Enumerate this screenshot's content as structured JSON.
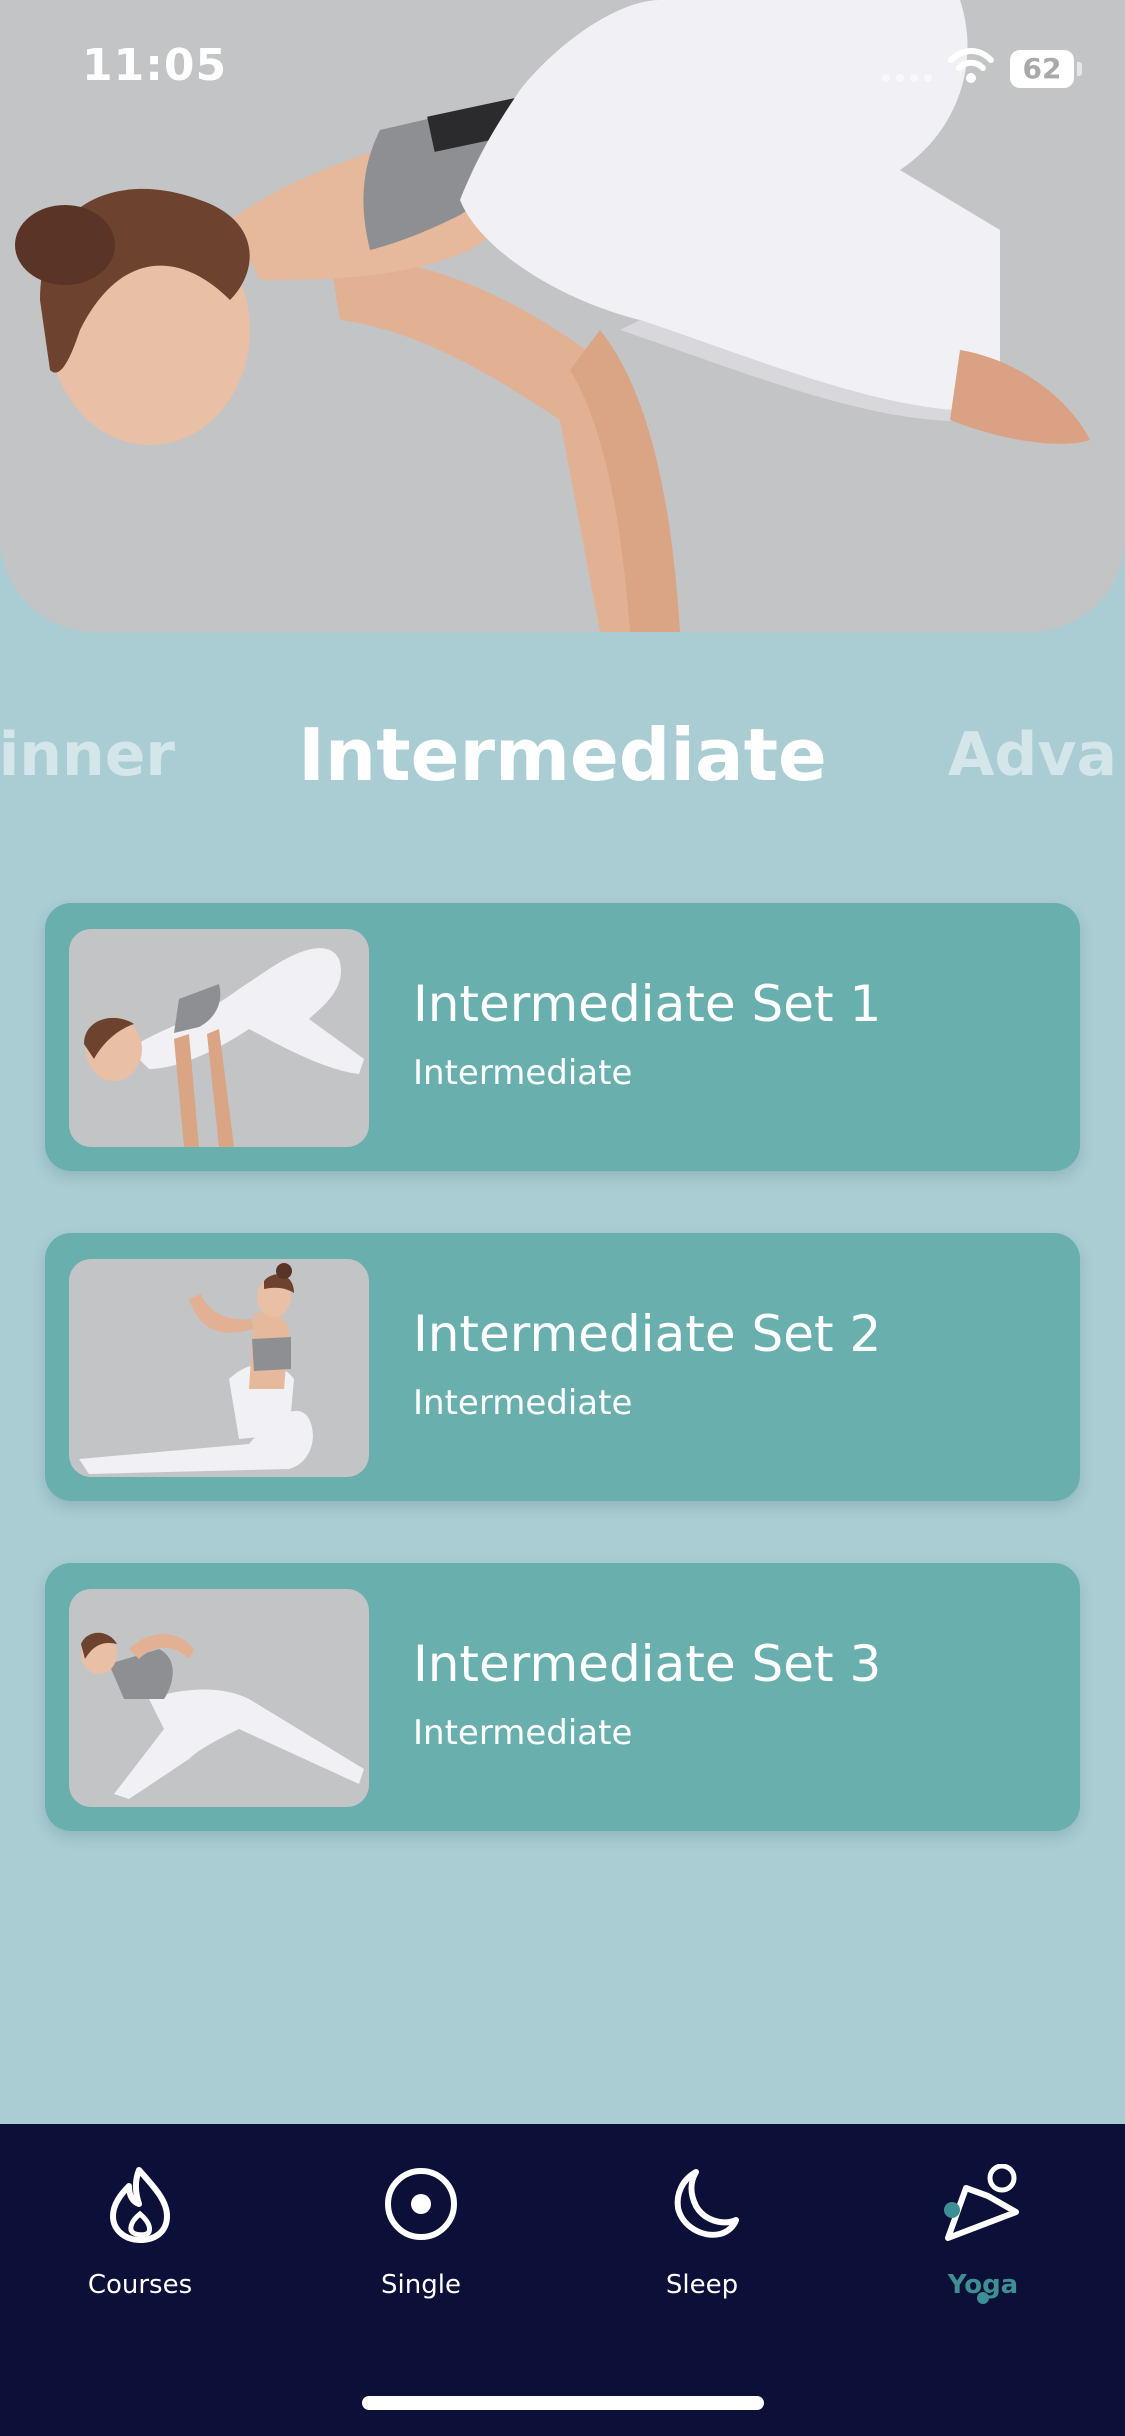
{
  "status_bar": {
    "time": "11:05",
    "battery": "62"
  },
  "hero": {
    "image": "yoga-crow-pose-photo"
  },
  "level_carousel": {
    "previous": "inner",
    "current": "Intermediate",
    "next": "Adva"
  },
  "sets": [
    {
      "title": "Intermediate Set 1",
      "level": "Intermediate",
      "image": "crow-pose-thumbnail"
    },
    {
      "title": "Intermediate Set 2",
      "level": "Intermediate",
      "image": "seated-twist-thumbnail"
    },
    {
      "title": "Intermediate Set 3",
      "level": "Intermediate",
      "image": "lunge-twist-thumbnail"
    }
  ],
  "tab_bar": {
    "tabs": [
      {
        "label": "Courses",
        "icon": "flame-icon"
      },
      {
        "label": "Single",
        "icon": "target-circle-icon"
      },
      {
        "label": "Sleep",
        "icon": "moon-icon"
      },
      {
        "label": "Yoga",
        "icon": "yoga-pose-icon",
        "active": true
      }
    ]
  },
  "colors": {
    "background": "#a9cdd3",
    "card": "#69afad",
    "tab_bar": "#0c1038",
    "accent": "#3e8f93"
  }
}
